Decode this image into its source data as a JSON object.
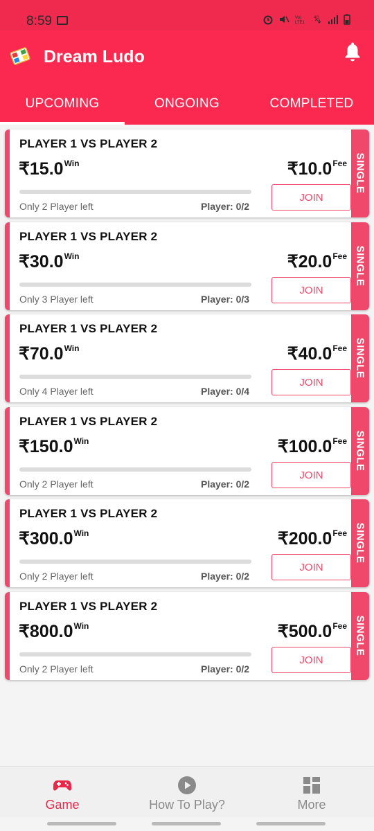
{
  "status_bar": {
    "time": "8:59"
  },
  "app": {
    "title": "Dream Ludo"
  },
  "tabs": [
    {
      "label": "UPCOMING"
    },
    {
      "label": "ONGOING"
    },
    {
      "label": "COMPLETED"
    }
  ],
  "matches": [
    {
      "title": "PLAYER 1 VS PLAYER 2",
      "win": "₹15.0",
      "win_sup": "Win",
      "fee": "₹10.0",
      "fee_sup": "Fee",
      "players_left": "Only 2 Player left",
      "player_count": "Player: 0/2",
      "fill": 0,
      "join_label": "JOIN",
      "type": "SINGLE"
    },
    {
      "title": "PLAYER 1 VS PLAYER 2",
      "win": "₹30.0",
      "win_sup": "Win",
      "fee": "₹20.0",
      "fee_sup": "Fee",
      "players_left": "Only 3 Player left",
      "player_count": "Player: 0/3",
      "fill": 0,
      "join_label": "JOIN",
      "type": "SINGLE"
    },
    {
      "title": "PLAYER 1 VS PLAYER 2",
      "win": "₹70.0",
      "win_sup": "Win",
      "fee": "₹40.0",
      "fee_sup": "Fee",
      "players_left": "Only 4 Player left",
      "player_count": "Player: 0/4",
      "fill": 0,
      "join_label": "JOIN",
      "type": "SINGLE"
    },
    {
      "title": "PLAYER 1 VS PLAYER 2",
      "win": "₹150.0",
      "win_sup": "Win",
      "fee": "₹100.0",
      "fee_sup": "Fee",
      "players_left": "Only 2 Player left",
      "player_count": "Player: 0/2",
      "fill": 0,
      "join_label": "JOIN",
      "type": "SINGLE"
    },
    {
      "title": "PLAYER 1 VS PLAYER 2",
      "win": "₹300.0",
      "win_sup": "Win",
      "fee": "₹200.0",
      "fee_sup": "Fee",
      "players_left": "Only 2 Player left",
      "player_count": "Player: 0/2",
      "fill": 0,
      "join_label": "JOIN",
      "type": "SINGLE"
    },
    {
      "title": "PLAYER 1 VS PLAYER 2",
      "win": "₹800.0",
      "win_sup": "Win",
      "fee": "₹500.0",
      "fee_sup": "Fee",
      "players_left": "Only 2 Player left",
      "player_count": "Player: 0/2",
      "fill": 0,
      "join_label": "JOIN",
      "type": "SINGLE"
    }
  ],
  "bottom_nav": [
    {
      "label": "Game",
      "icon": "gamepad-icon",
      "active": true
    },
    {
      "label": "How To Play?",
      "icon": "play-circle-icon",
      "active": false
    },
    {
      "label": "More",
      "icon": "grid-icon",
      "active": false
    }
  ],
  "colors": {
    "primary": "#fb2950",
    "accent": "#f0486a",
    "active_nav": "#e8274b",
    "inactive_nav": "#8a8a8a"
  }
}
